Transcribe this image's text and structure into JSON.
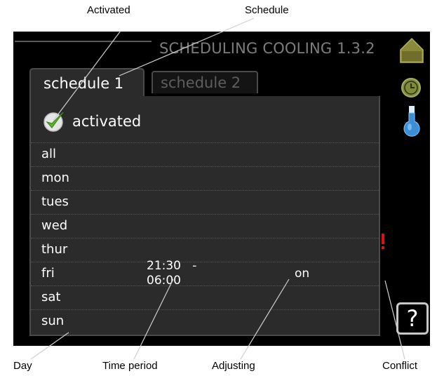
{
  "callouts": {
    "activated": "Activated",
    "schedule": "Schedule",
    "day": "Day",
    "time_period": "Time period",
    "adjusting": "Adjusting",
    "conflict": "Conflict"
  },
  "screen": {
    "title": "SCHEDULING COOLING 1.3.2",
    "tabs": [
      {
        "label": "schedule 1",
        "active": true
      },
      {
        "label": "schedule 2",
        "active": false
      }
    ],
    "activated": {
      "label": "activated",
      "checked": true
    },
    "days": [
      "all",
      "mon",
      "tues",
      "wed",
      "thur",
      "fri",
      "sat",
      "sun"
    ],
    "entry": {
      "day": "fri",
      "time_period": "21:30   -\n06:00",
      "adjusting": "on",
      "conflict_color": "#e01010"
    },
    "side_icons": [
      "home-icon",
      "clock-icon",
      "thermometer-icon"
    ],
    "help_label": "?"
  },
  "colors": {
    "screen_bg": "#000000",
    "panel_bg": "#2b2b2b",
    "title_gray": "#7d7d7d",
    "check_green": "#58b82c",
    "home_olive": "#8b8a3a",
    "flask_blue": "#3a8fd6"
  }
}
